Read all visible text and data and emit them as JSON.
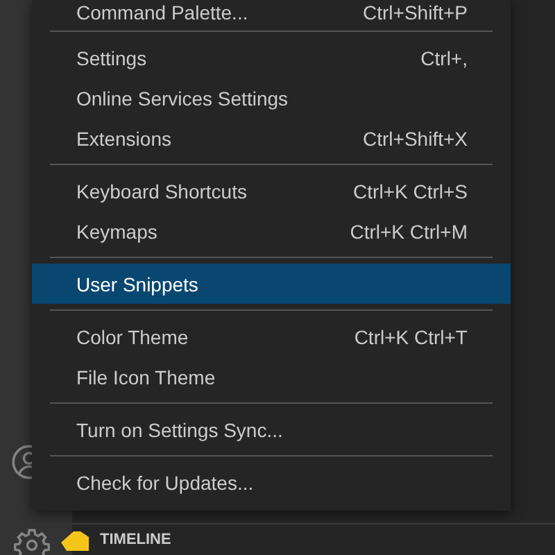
{
  "menu": {
    "items": [
      {
        "kind": "item",
        "label": "Command Palette...",
        "shortcut": "Ctrl+Shift+P",
        "selected": false
      },
      {
        "kind": "separator"
      },
      {
        "kind": "item",
        "label": "Settings",
        "shortcut": "Ctrl+,",
        "selected": false
      },
      {
        "kind": "item",
        "label": "Online Services Settings",
        "selected": false
      },
      {
        "kind": "item",
        "label": "Extensions",
        "shortcut": "Ctrl+Shift+X",
        "selected": false
      },
      {
        "kind": "separator"
      },
      {
        "kind": "item",
        "label": "Keyboard Shortcuts",
        "shortcut": "Ctrl+K Ctrl+S",
        "selected": false
      },
      {
        "kind": "item",
        "label": "Keymaps",
        "shortcut": "Ctrl+K Ctrl+M",
        "selected": false
      },
      {
        "kind": "separator"
      },
      {
        "kind": "item",
        "label": "User Snippets",
        "selected": true
      },
      {
        "kind": "separator"
      },
      {
        "kind": "item",
        "label": "Color Theme",
        "shortcut": "Ctrl+K Ctrl+T",
        "selected": false
      },
      {
        "kind": "item",
        "label": "File Icon Theme",
        "selected": false
      },
      {
        "kind": "separator"
      },
      {
        "kind": "item",
        "label": "Turn on Settings Sync...",
        "selected": false
      },
      {
        "kind": "separator"
      },
      {
        "kind": "item",
        "label": "Check for Updates...",
        "selected": false
      }
    ]
  },
  "sidebar": {
    "panels": [
      {
        "title": "TIMELINE"
      }
    ]
  }
}
